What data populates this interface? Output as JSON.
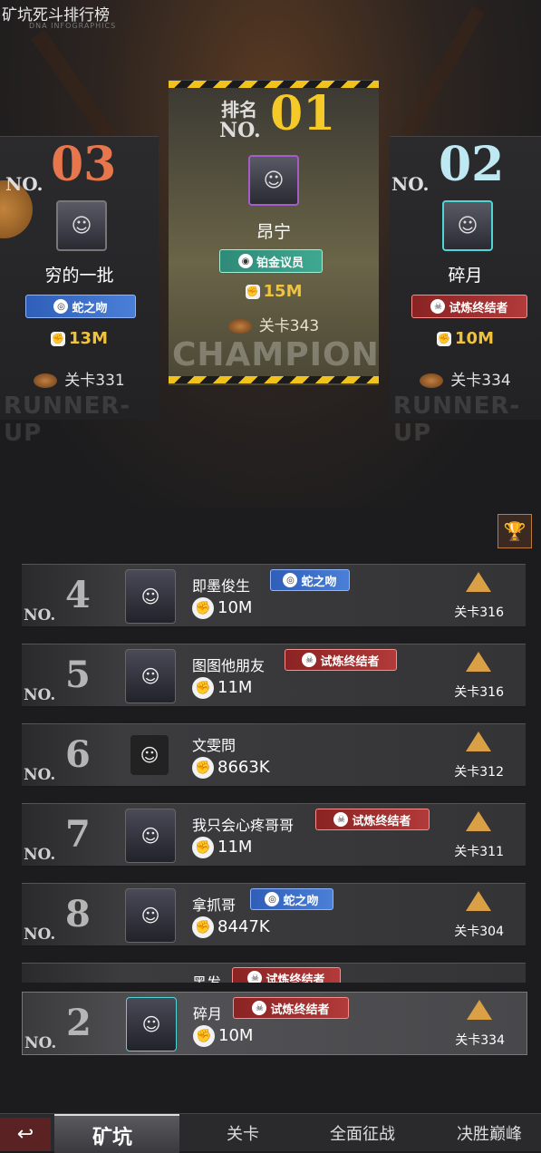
{
  "header": {
    "title": "矿坑死斗排行榜",
    "subtitle": "DNA INFOGRAPHICS"
  },
  "podium": {
    "first": {
      "rank_label": "排名",
      "no": "NO.",
      "rank": "01",
      "name": "昂宁",
      "badge": "铂金议员",
      "power": "15M",
      "stage": "关卡343",
      "watermark": "CHAMPION"
    },
    "second": {
      "no": "NO.",
      "rank": "02",
      "name": "碎月",
      "badge": "试炼终结者",
      "power": "10M",
      "stage": "关卡334",
      "watermark": "RUNNER-UP"
    },
    "third": {
      "no": "NO.",
      "rank": "03",
      "name": "穷的一批",
      "badge": "蛇之吻",
      "power": "13M",
      "stage": "关卡331",
      "watermark": "RUNNER-UP"
    }
  },
  "rows": [
    {
      "rank": "4",
      "no": "NO.",
      "name": "即墨俊生",
      "badge": "蛇之吻",
      "badge_color": "#3a6cc8",
      "power": "10M",
      "stage": "关卡316"
    },
    {
      "rank": "5",
      "no": "NO.",
      "name": "图图他朋友",
      "badge": "试炼终结者",
      "badge_color": "#a12f2f",
      "power": "11M",
      "stage": "关卡316"
    },
    {
      "rank": "6",
      "no": "NO.",
      "name": "文雯問",
      "badge": "",
      "power": "8663K",
      "stage": "关卡312"
    },
    {
      "rank": "7",
      "no": "NO.",
      "name": "我只会心疼哥哥",
      "badge": "试炼终结者",
      "badge_color": "#a12f2f",
      "power": "11M",
      "stage": "关卡311"
    },
    {
      "rank": "8",
      "no": "NO.",
      "name": "拿抓哥",
      "badge": "蛇之吻",
      "badge_color": "#3a6cc8",
      "power": "8447K",
      "stage": "关卡304"
    }
  ],
  "partial_row": {
    "name": "黑发",
    "badge": "试炼终结者"
  },
  "my_rank": {
    "rank": "2",
    "no": "NO.",
    "name": "碎月",
    "badge": "试炼终结者",
    "power": "10M",
    "stage": "关卡334"
  },
  "icons": {
    "trophy": "trophy-icon",
    "fist": "fist-icon",
    "pyramid": "pyramid-icon",
    "cookie": "stage-icon"
  },
  "tabs": [
    {
      "label": "矿坑",
      "active": true
    },
    {
      "label": "关卡",
      "active": false
    },
    {
      "label": "全面征战",
      "active": false
    },
    {
      "label": "决胜巅峰",
      "active": false
    }
  ],
  "back_icon": "back-arrow-icon"
}
